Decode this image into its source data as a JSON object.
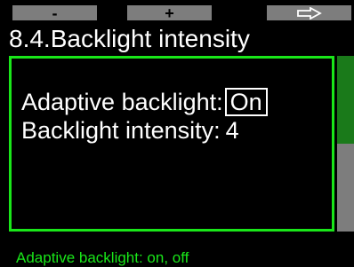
{
  "softkeys": {
    "minus_label": "-",
    "plus_label": "+",
    "next_icon": "right-arrow-icon"
  },
  "page_title": "8.4.Backlight intensity",
  "settings": [
    {
      "label": "Adaptive backlight:",
      "value": "On",
      "selected": true
    },
    {
      "label": "Backlight intensity:",
      "value": "4",
      "selected": false
    }
  ],
  "scrollbar": {
    "position_fraction": 0.0,
    "visible_fraction": 0.5
  },
  "hint": "Adaptive backlight: on, off",
  "colors": {
    "accent_green": "#19e619",
    "dark_green": "#1a7a1a",
    "softkey_gray": "#7d7d7d",
    "background": "#000000",
    "text": "#ffffff"
  }
}
